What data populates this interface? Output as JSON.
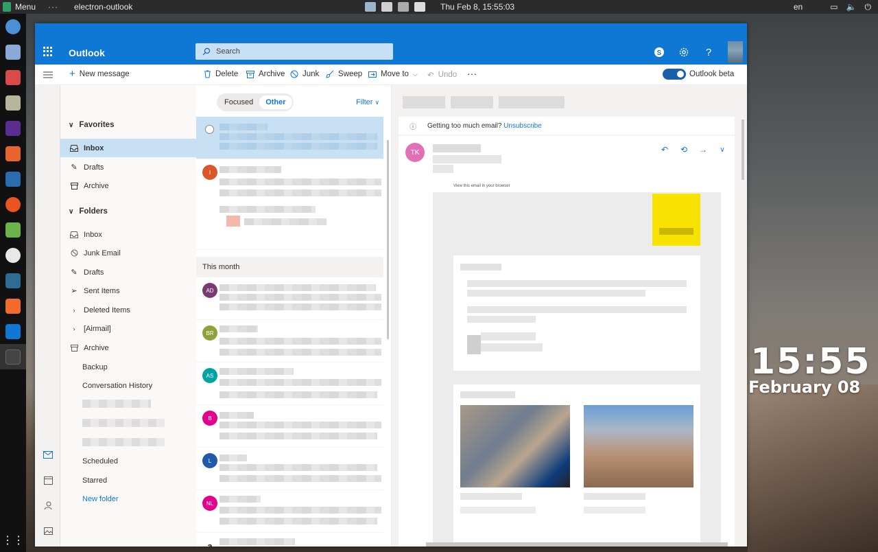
{
  "system": {
    "menu_label": "Menu",
    "dots": "···",
    "active_app": "electron-outlook",
    "clock": "Thu Feb  8, 15:55:03",
    "lang": "en",
    "desktop_time": "15:55",
    "desktop_date": "February 08"
  },
  "header": {
    "brand": "Outlook",
    "search_placeholder": "Search"
  },
  "commands": {
    "new_message": "New message",
    "delete": "Delete",
    "archive": "Archive",
    "junk": "Junk",
    "sweep": "Sweep",
    "move_to": "Move to",
    "undo": "Undo",
    "more": "···",
    "beta_label": "Outlook beta"
  },
  "favorites": {
    "title": "Favorites",
    "items": [
      "Inbox",
      "Drafts",
      "Archive"
    ]
  },
  "folders": {
    "title": "Folders",
    "items": [
      "Inbox",
      "Junk Email",
      "Drafts",
      "Sent Items",
      "Deleted Items",
      "[Airmail]",
      "Archive",
      "Backup",
      "Conversation History",
      "Scheduled",
      "Starred"
    ],
    "new_folder": "New folder"
  },
  "list": {
    "tab_focused": "Focused",
    "tab_other": "Other",
    "filter": "Filter",
    "group_this_month": "This month",
    "avatars": [
      "I",
      "AD",
      "BR",
      "AS",
      "B",
      "L",
      "NL",
      "a"
    ]
  },
  "reading": {
    "notice_text": "Getting too much email?",
    "unsubscribe": "Unsubscribe",
    "sender_initials": "TK",
    "view_in_browser": "View this email in your browser"
  },
  "colors": {
    "brand_blue": "#0f78d4",
    "selected_bg": "#c7e0f4",
    "avatar_I": "#d9572b",
    "avatar_AD": "#7a3a73",
    "avatar_BR": "#8da33a",
    "avatar_AS": "#00a3a3",
    "avatar_B": "#e3008c",
    "avatar_L": "#1e5aa8",
    "avatar_NL": "#e3008c",
    "avatar_TK": "#e170b6"
  }
}
